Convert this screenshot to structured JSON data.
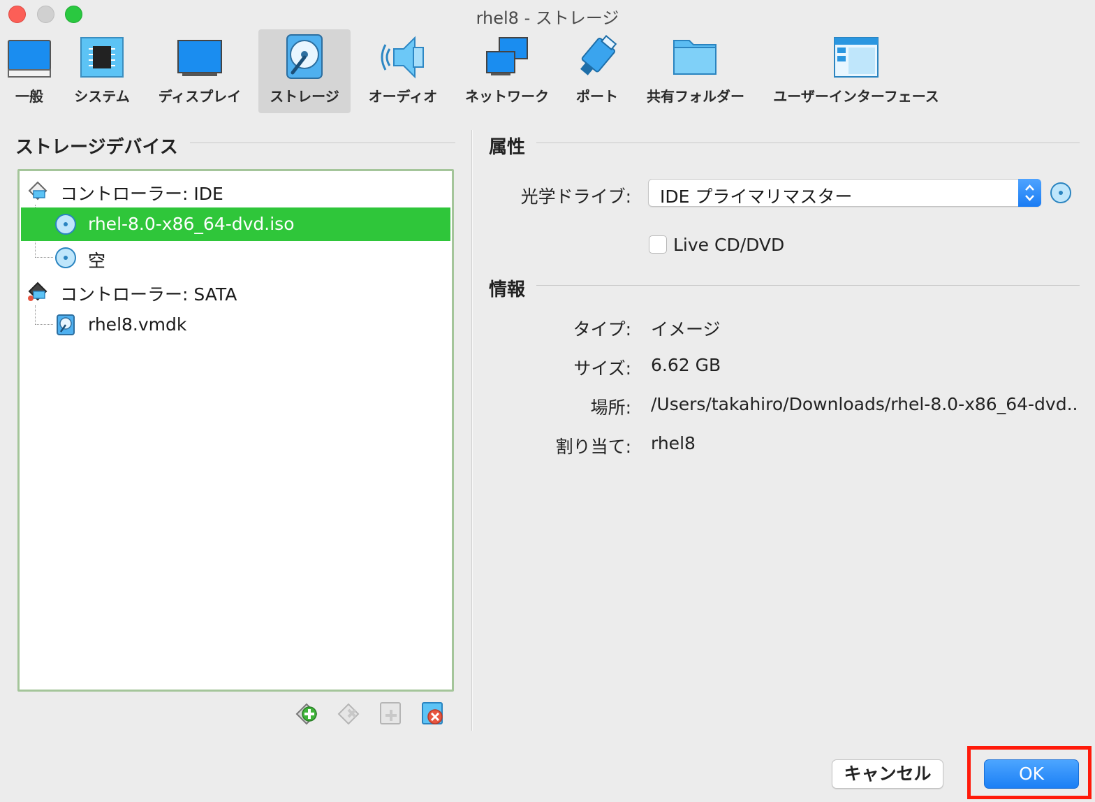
{
  "window": {
    "title": "rhel8 - ストレージ"
  },
  "toolbar": {
    "items": [
      {
        "label": "一般",
        "icon": "general-monitor-icon"
      },
      {
        "label": "システム",
        "icon": "chip-icon"
      },
      {
        "label": "ディスプレイ",
        "icon": "display-icon"
      },
      {
        "label": "ストレージ",
        "icon": "storage-disk-icon",
        "selected": true
      },
      {
        "label": "オーディオ",
        "icon": "speaker-icon"
      },
      {
        "label": "ネットワーク",
        "icon": "network-icon"
      },
      {
        "label": "ポート",
        "icon": "port-plug-icon"
      },
      {
        "label": "共有フォルダー",
        "icon": "folder-icon"
      },
      {
        "label": "ユーザーインターフェース",
        "icon": "ui-window-icon"
      }
    ]
  },
  "storage_devices": {
    "title": "ストレージデバイス",
    "tree": [
      {
        "label": "コントローラー: IDE",
        "type": "controller",
        "icon": "ide-controller-icon"
      },
      {
        "label": "rhel-8.0-x86_64-dvd.iso",
        "type": "optical",
        "icon": "cd-icon",
        "selected": true
      },
      {
        "label": "空",
        "type": "optical",
        "icon": "cd-icon"
      },
      {
        "label": "コントローラー: SATA",
        "type": "controller",
        "icon": "sata-controller-icon"
      },
      {
        "label": "rhel8.vmdk",
        "type": "disk",
        "icon": "hard-disk-icon"
      }
    ],
    "buttons": [
      "add-controller-icon",
      "remove-controller-icon",
      "add-attachment-icon",
      "remove-attachment-icon"
    ]
  },
  "attributes": {
    "title": "属性",
    "optical_drive_label": "光学ドライブ:",
    "optical_drive_value": "IDE プライマリマスター",
    "live_cd_label": "Live CD/DVD",
    "live_cd_checked": false
  },
  "information": {
    "title": "情報",
    "rows": [
      {
        "label": "タイプ:",
        "value": "イメージ"
      },
      {
        "label": "サイズ:",
        "value": "6.62 GB"
      },
      {
        "label": "場所:",
        "value": "/Users/takahiro/Downloads/rhel-8.0-x86_64-dvd..."
      },
      {
        "label": "割り当て:",
        "value": "rhel8"
      }
    ]
  },
  "footer": {
    "cancel_label": "キャンセル",
    "ok_label": "OK"
  },
  "colors": {
    "selection": "#2fc63a",
    "accent_blue": "#1b7ff5",
    "highlight_red": "#ff1a0a"
  }
}
